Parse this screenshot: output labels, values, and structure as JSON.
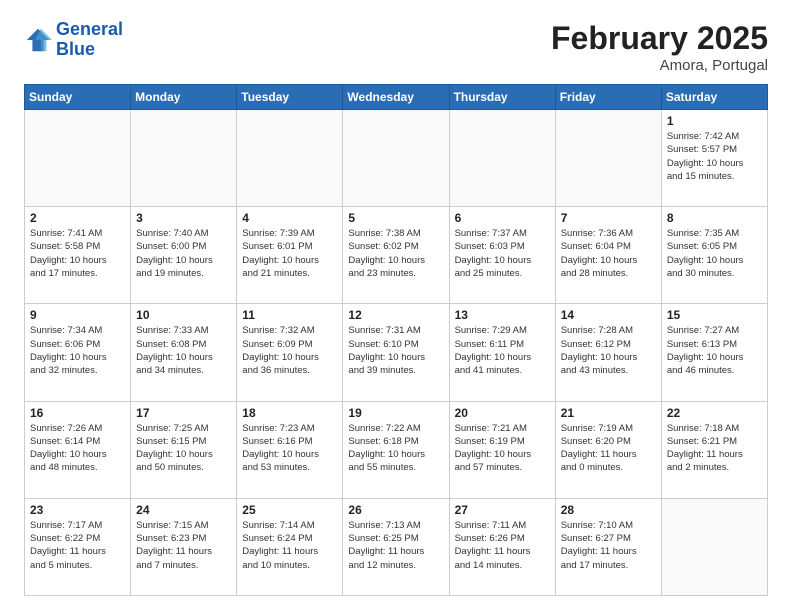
{
  "header": {
    "logo_line1": "General",
    "logo_line2": "Blue",
    "month_title": "February 2025",
    "location": "Amora, Portugal"
  },
  "weekdays": [
    "Sunday",
    "Monday",
    "Tuesday",
    "Wednesday",
    "Thursday",
    "Friday",
    "Saturday"
  ],
  "weeks": [
    [
      {
        "day": "",
        "info": ""
      },
      {
        "day": "",
        "info": ""
      },
      {
        "day": "",
        "info": ""
      },
      {
        "day": "",
        "info": ""
      },
      {
        "day": "",
        "info": ""
      },
      {
        "day": "",
        "info": ""
      },
      {
        "day": "1",
        "info": "Sunrise: 7:42 AM\nSunset: 5:57 PM\nDaylight: 10 hours\nand 15 minutes."
      }
    ],
    [
      {
        "day": "2",
        "info": "Sunrise: 7:41 AM\nSunset: 5:58 PM\nDaylight: 10 hours\nand 17 minutes."
      },
      {
        "day": "3",
        "info": "Sunrise: 7:40 AM\nSunset: 6:00 PM\nDaylight: 10 hours\nand 19 minutes."
      },
      {
        "day": "4",
        "info": "Sunrise: 7:39 AM\nSunset: 6:01 PM\nDaylight: 10 hours\nand 21 minutes."
      },
      {
        "day": "5",
        "info": "Sunrise: 7:38 AM\nSunset: 6:02 PM\nDaylight: 10 hours\nand 23 minutes."
      },
      {
        "day": "6",
        "info": "Sunrise: 7:37 AM\nSunset: 6:03 PM\nDaylight: 10 hours\nand 25 minutes."
      },
      {
        "day": "7",
        "info": "Sunrise: 7:36 AM\nSunset: 6:04 PM\nDaylight: 10 hours\nand 28 minutes."
      },
      {
        "day": "8",
        "info": "Sunrise: 7:35 AM\nSunset: 6:05 PM\nDaylight: 10 hours\nand 30 minutes."
      }
    ],
    [
      {
        "day": "9",
        "info": "Sunrise: 7:34 AM\nSunset: 6:06 PM\nDaylight: 10 hours\nand 32 minutes."
      },
      {
        "day": "10",
        "info": "Sunrise: 7:33 AM\nSunset: 6:08 PM\nDaylight: 10 hours\nand 34 minutes."
      },
      {
        "day": "11",
        "info": "Sunrise: 7:32 AM\nSunset: 6:09 PM\nDaylight: 10 hours\nand 36 minutes."
      },
      {
        "day": "12",
        "info": "Sunrise: 7:31 AM\nSunset: 6:10 PM\nDaylight: 10 hours\nand 39 minutes."
      },
      {
        "day": "13",
        "info": "Sunrise: 7:29 AM\nSunset: 6:11 PM\nDaylight: 10 hours\nand 41 minutes."
      },
      {
        "day": "14",
        "info": "Sunrise: 7:28 AM\nSunset: 6:12 PM\nDaylight: 10 hours\nand 43 minutes."
      },
      {
        "day": "15",
        "info": "Sunrise: 7:27 AM\nSunset: 6:13 PM\nDaylight: 10 hours\nand 46 minutes."
      }
    ],
    [
      {
        "day": "16",
        "info": "Sunrise: 7:26 AM\nSunset: 6:14 PM\nDaylight: 10 hours\nand 48 minutes."
      },
      {
        "day": "17",
        "info": "Sunrise: 7:25 AM\nSunset: 6:15 PM\nDaylight: 10 hours\nand 50 minutes."
      },
      {
        "day": "18",
        "info": "Sunrise: 7:23 AM\nSunset: 6:16 PM\nDaylight: 10 hours\nand 53 minutes."
      },
      {
        "day": "19",
        "info": "Sunrise: 7:22 AM\nSunset: 6:18 PM\nDaylight: 10 hours\nand 55 minutes."
      },
      {
        "day": "20",
        "info": "Sunrise: 7:21 AM\nSunset: 6:19 PM\nDaylight: 10 hours\nand 57 minutes."
      },
      {
        "day": "21",
        "info": "Sunrise: 7:19 AM\nSunset: 6:20 PM\nDaylight: 11 hours\nand 0 minutes."
      },
      {
        "day": "22",
        "info": "Sunrise: 7:18 AM\nSunset: 6:21 PM\nDaylight: 11 hours\nand 2 minutes."
      }
    ],
    [
      {
        "day": "23",
        "info": "Sunrise: 7:17 AM\nSunset: 6:22 PM\nDaylight: 11 hours\nand 5 minutes."
      },
      {
        "day": "24",
        "info": "Sunrise: 7:15 AM\nSunset: 6:23 PM\nDaylight: 11 hours\nand 7 minutes."
      },
      {
        "day": "25",
        "info": "Sunrise: 7:14 AM\nSunset: 6:24 PM\nDaylight: 11 hours\nand 10 minutes."
      },
      {
        "day": "26",
        "info": "Sunrise: 7:13 AM\nSunset: 6:25 PM\nDaylight: 11 hours\nand 12 minutes."
      },
      {
        "day": "27",
        "info": "Sunrise: 7:11 AM\nSunset: 6:26 PM\nDaylight: 11 hours\nand 14 minutes."
      },
      {
        "day": "28",
        "info": "Sunrise: 7:10 AM\nSunset: 6:27 PM\nDaylight: 11 hours\nand 17 minutes."
      },
      {
        "day": "",
        "info": ""
      }
    ]
  ]
}
